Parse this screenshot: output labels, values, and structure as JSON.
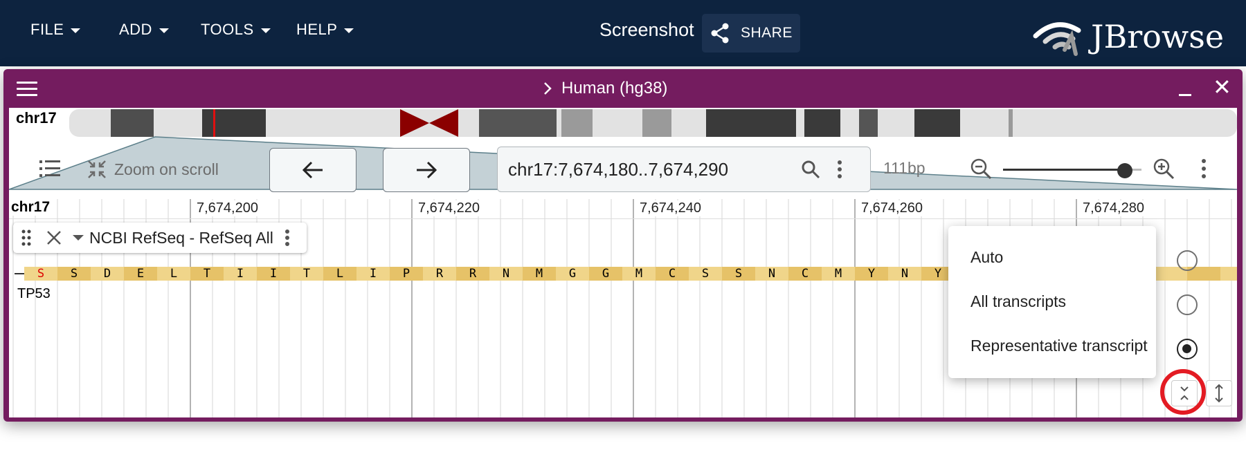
{
  "menu": [
    {
      "label": "FILE"
    },
    {
      "label": "ADD"
    },
    {
      "label": "TOOLS"
    },
    {
      "label": "HELP"
    }
  ],
  "session_name": "Screenshot",
  "share_label": "SHARE",
  "logo_text": "JBrowse",
  "view": {
    "title": "Human (hg38)",
    "chromosome": "chr17",
    "zoom_on_scroll_label": "Zoom on scroll",
    "locstring": "chr17:7,674,180..7,674,290",
    "bp_width": "111bp",
    "zoom_level_fraction": 0.88
  },
  "ruler": {
    "chromosome": "chr17",
    "ticks": [
      "7,674,200",
      "7,674,220",
      "7,674,240",
      "7,674,260",
      "7,674,280"
    ]
  },
  "track": {
    "name": "NCBI RefSeq - RefSeq All",
    "gene_name": "TP53",
    "amino_acids": [
      "S",
      "S",
      "D",
      "E",
      "L",
      "T",
      "I",
      "I",
      "T",
      "L",
      "I",
      "P",
      "R",
      "R",
      "N",
      "M",
      "G",
      "G",
      "M",
      "C",
      "S",
      "S",
      "N",
      "C",
      "M",
      "Y",
      "N",
      "Y"
    ]
  },
  "display_mode_menu": {
    "options": [
      {
        "label": "Auto",
        "selected": false
      },
      {
        "label": "All transcripts",
        "selected": false
      },
      {
        "label": "Representative transcript",
        "selected": true
      }
    ]
  },
  "colors": {
    "header_bg": "#0d233f",
    "view_header_bg": "#741c5f",
    "highlight_circle": "#e31b23",
    "aa_light": "#f0d58a",
    "aa_dark": "#e6c268"
  }
}
